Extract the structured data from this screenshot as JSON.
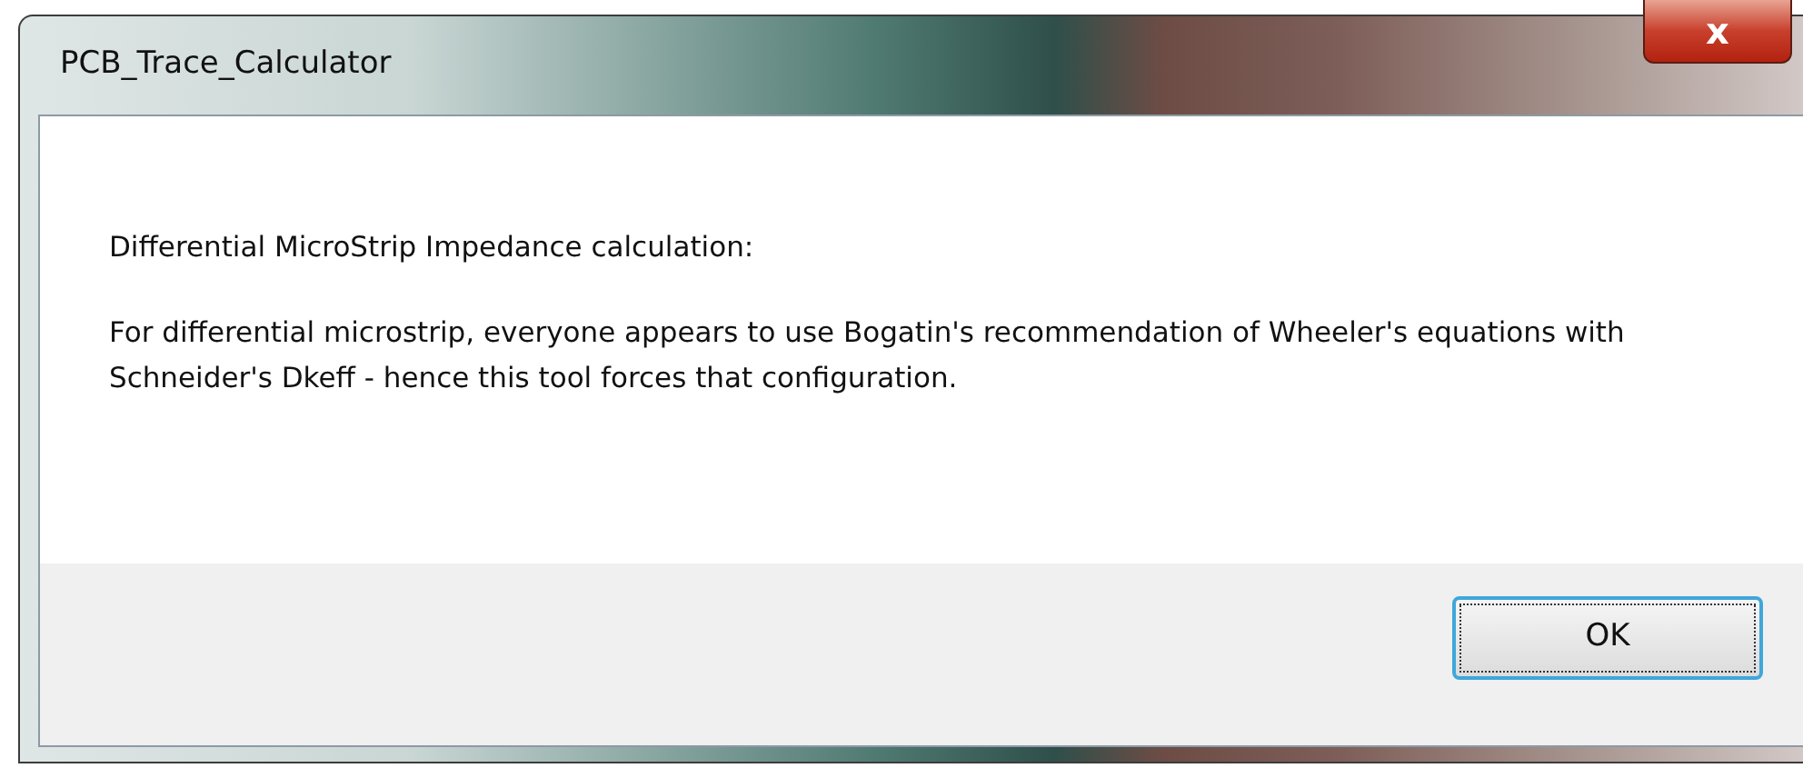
{
  "window": {
    "title": "PCB_Trace_Calculator",
    "close_glyph": "x"
  },
  "message": {
    "heading": "Differential MicroStrip Impedance calculation:",
    "body": "For differential microstrip, everyone appears to use Bogatin's recommendation of Wheeler's equations with Schneider's Dkeff - hence this tool forces that configuration."
  },
  "buttons": [
    {
      "label": "OK",
      "focused": true
    }
  ]
}
